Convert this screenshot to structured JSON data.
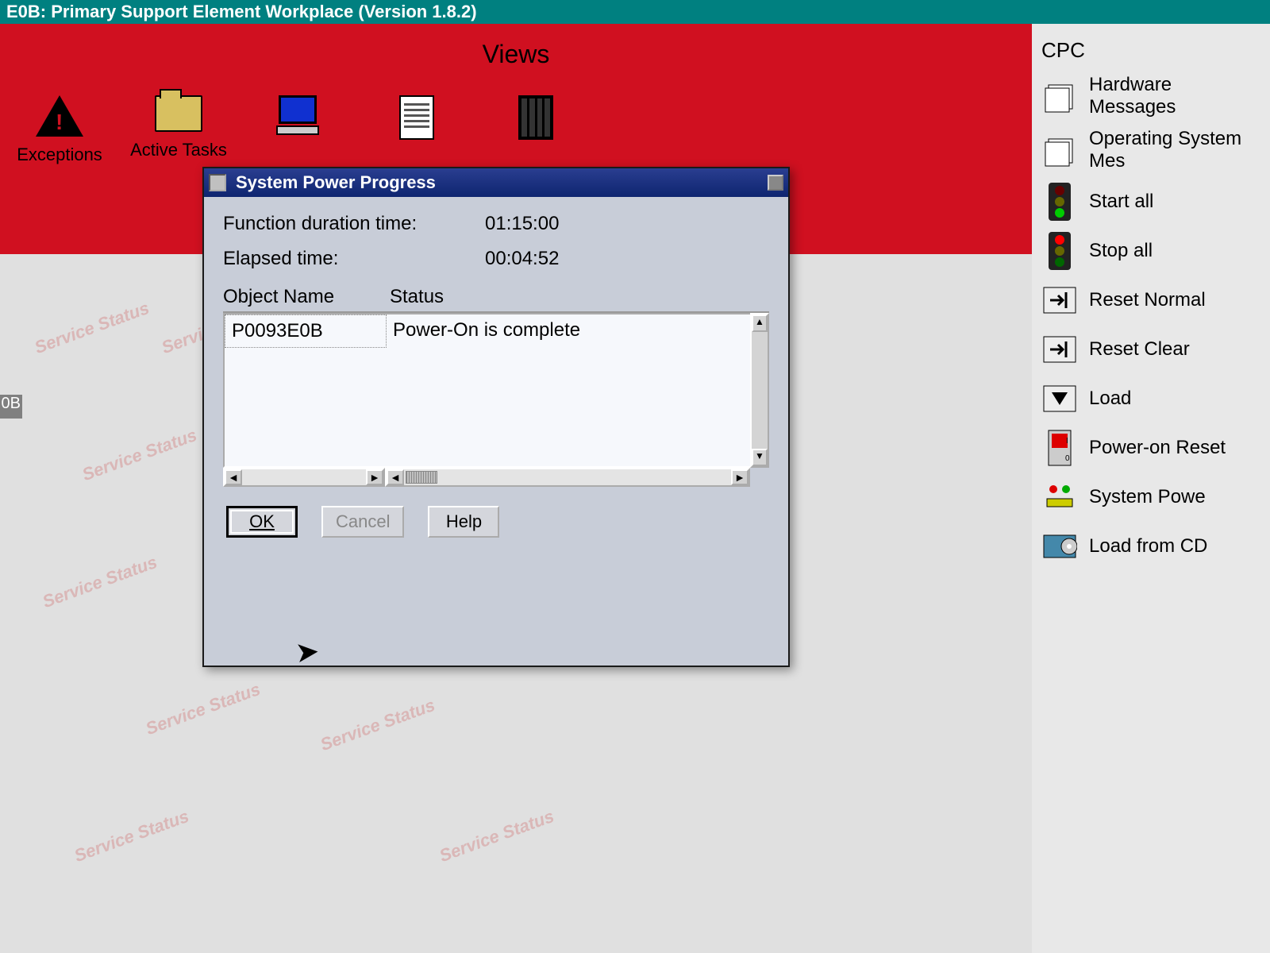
{
  "window": {
    "title": "E0B: Primary Support Element Workplace (Version 1.8.2)"
  },
  "views": {
    "title": "Views",
    "items": [
      {
        "label": "Exceptions"
      },
      {
        "label": "Active Tasks"
      }
    ]
  },
  "left_tab": "0B",
  "sidebar": {
    "title": "CPC",
    "items": [
      {
        "label": "Hardware Messages",
        "icon": "messages"
      },
      {
        "label": "Operating System Mes",
        "icon": "messages"
      },
      {
        "label": "Start all",
        "icon": "traffic-green"
      },
      {
        "label": "Stop all",
        "icon": "traffic-red"
      },
      {
        "label": "Reset Normal",
        "icon": "reset"
      },
      {
        "label": "Reset Clear",
        "icon": "reset"
      },
      {
        "label": "Load",
        "icon": "load"
      },
      {
        "label": "Power-on Reset",
        "icon": "switch"
      },
      {
        "label": "System Powe",
        "icon": "system-power"
      },
      {
        "label": "Load from CD",
        "icon": "cd"
      }
    ]
  },
  "dialog": {
    "title": "System Power Progress",
    "duration_label": "Function duration time:",
    "duration_value": "01:15:00",
    "elapsed_label": "Elapsed time:",
    "elapsed_value": "00:04:52",
    "col_object": "Object Name",
    "col_status": "Status",
    "rows": [
      {
        "object": "P0093E0B",
        "status": "Power-On is complete"
      }
    ],
    "buttons": {
      "ok": "OK",
      "cancel": "Cancel",
      "help": "Help"
    }
  },
  "watermark": "Service Status"
}
